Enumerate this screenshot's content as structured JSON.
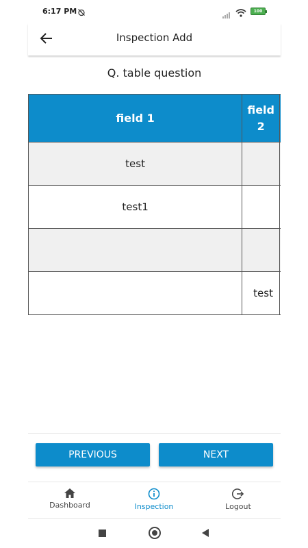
{
  "status_bar": {
    "time": "6:17 PM",
    "battery": "100"
  },
  "app_bar": {
    "title": "Inspection Add"
  },
  "question": "Q. table question",
  "table": {
    "headers": [
      "field 1",
      "field\n2"
    ],
    "rows": [
      [
        "test",
        ""
      ],
      [
        "test1",
        ""
      ],
      [
        "",
        ""
      ],
      [
        "",
        "test"
      ]
    ]
  },
  "buttons": {
    "previous": "PREVIOUS",
    "next": "NEXT"
  },
  "bottom_nav": {
    "items": [
      {
        "label": "Dashboard",
        "icon": "home-icon",
        "active": false
      },
      {
        "label": "Inspection",
        "icon": "info-icon",
        "active": true
      },
      {
        "label": "Logout",
        "icon": "logout-icon",
        "active": false
      }
    ]
  },
  "colors": {
    "accent": "#0d8ccb",
    "row_shade": "#f0f0f0"
  }
}
